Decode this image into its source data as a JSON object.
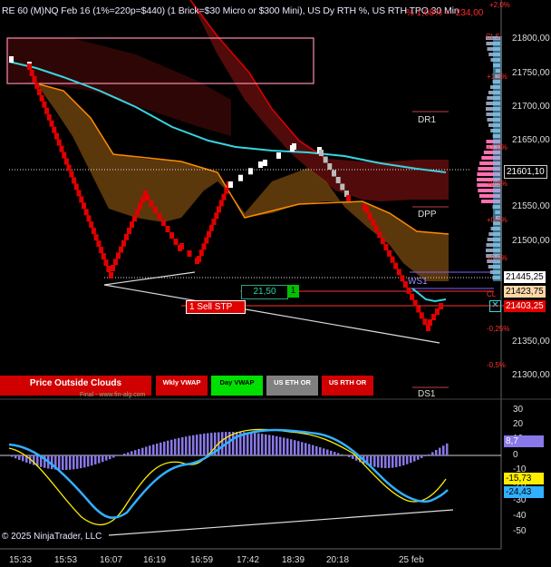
{
  "header": {
    "title": "RE 60 (M)NQ Feb 16  (1%=220p=$440) (1 Brick=$30 Micro or $300 Mini), US Dy RTH %, US RTH TPO 30 Min",
    "change_pct": "% 1,08% = -234,00"
  },
  "price_axis": {
    "labels": [
      "21800,00",
      "21750,00",
      "21700,00",
      "21650,00",
      "21550,00",
      "21500,00",
      "21350,00",
      "21300,00"
    ],
    "percent_labels": [
      "+2,0%",
      "+1,5%",
      "+1,0%",
      "+0,5%",
      "-0,5%",
      "+0,0%",
      "-0,25%",
      "-0,5%"
    ],
    "tags": {
      "last_price": "21601,10",
      "level_1": "21445,25",
      "level_2": "21423,75",
      "level_3": "21403,25"
    }
  },
  "levels": {
    "dr1": "DR1",
    "dpp": "DPP",
    "ws1": "WS1",
    "ds1": "DS1",
    "cls": "CLS",
    "cl": "CL"
  },
  "status_boxes": {
    "price_outside_clouds": "Price Outside Clouds",
    "wkly_vwap": "Wkly VWAP",
    "day_vwap": "Day VWAP",
    "us_eth_or": "US ETH OR",
    "us_rth_or": "US RTH OR"
  },
  "order": {
    "sell_label": "1  Sell STP",
    "qty_value": "21,50",
    "qty_count": "1"
  },
  "oscillator": {
    "axis_labels": [
      "30",
      "20",
      "10",
      "0",
      "-10",
      "-20",
      "-30",
      "-40",
      "-50"
    ],
    "tags": {
      "v1": "8,7",
      "v2": "-15,73",
      "v3": "-24,43"
    }
  },
  "time_axis": [
    "15:33",
    "15:53",
    "16:07",
    "16:19",
    "16:59",
    "17:42",
    "18:39",
    "20:18",
    "25 feb"
  ],
  "watermark": "Final - www.fin-alg.com",
  "copyright": "© 2025 NinjaTrader, LLC",
  "colors": {
    "bull_brick": "#ffffff",
    "bear_brick": "#e00000",
    "ma_line": "#38d4e0",
    "cloud_orange": "#ff8c00",
    "cloud_red": "#6a1010",
    "macd_fast": "#30b0ff",
    "macd_slow": "#ffee00",
    "histogram": "#8878e8"
  }
}
